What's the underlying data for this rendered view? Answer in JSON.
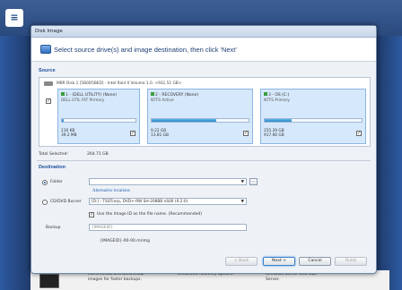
{
  "window": {
    "title": "Disk Image"
  },
  "header": {
    "text": "Select source drive(s) and image destination, then click 'Next'"
  },
  "source": {
    "label": "Source",
    "disk_label": "MBR Disk 1 [5B0D5BED] - Intel  Raid 0 Volume 1.0.  <931.51 GB>",
    "partitions": [
      {
        "name": "1 - (DELL UTILITY) (None)",
        "type": "DELL UTIL FAT Primary",
        "used": "116 KB",
        "total": "39.2 MB",
        "fill": 0.03
      },
      {
        "name": "2 - RECOVERY (None)",
        "type": "NTFS Active",
        "used": "9.22 GB",
        "total": "13.81 GB",
        "fill": 0.67
      },
      {
        "name": "3 - OS (C:)",
        "type": "NTFS Primary",
        "used": "255.29 GB",
        "total": "917.66 GB",
        "fill": 0.28
      }
    ],
    "total_label": "Total Selected:",
    "total_value": "264.71 GB"
  },
  "destination": {
    "label": "Destination",
    "folder_label": "Folder",
    "folder_value": "",
    "alt_link": "Alternative locations",
    "cd_label": "CD/DVD Burner",
    "cd_value": "[D:] - TSSTcorp, DVD+-RW SH-208BB nS00 (0:2:0)",
    "use_backup_id": "Use the Image ID as the file name.  (Recommended)",
    "backup_label": "Backup",
    "backup_value": "{IMAGEID}",
    "filename": "{IMAGEID}-00-00.mrimg",
    "browse_label": "..."
  },
  "buttons": {
    "back": "< Back",
    "next": "Next >",
    "cancel": "Cancel",
    "finish": "Finish"
  },
  "background_features": [
    "Incremental and differential images for faster backups.",
    "Enhanced recovery options.",
    "Windows Server and SQL Server.",
    "Windows Server support with the Server Edition."
  ],
  "colors": {
    "accent": "#1d4f9a",
    "partition_fill": "#2a88c9",
    "desktop": "#1f3b6b"
  }
}
